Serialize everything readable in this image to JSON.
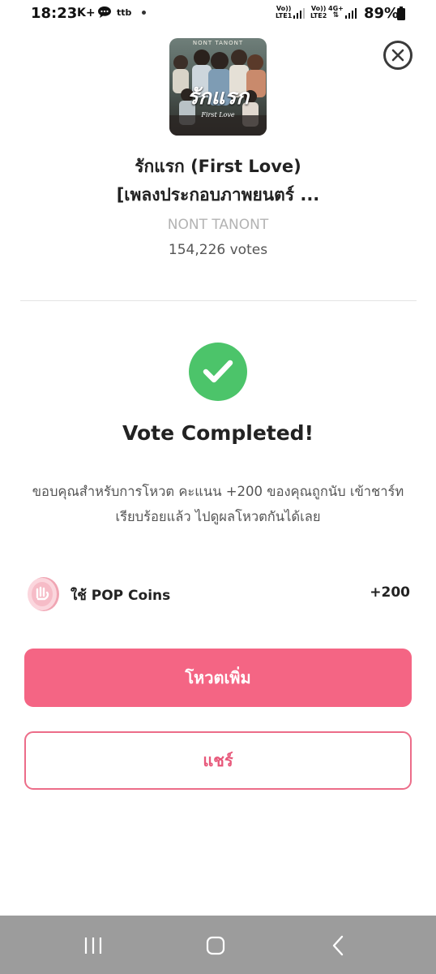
{
  "status_bar": {
    "time": "18:23",
    "carrier_icons": "K+",
    "ttb": "ttb",
    "net1_top": "Vo))",
    "net1_bottom": "LTE1",
    "net2_top": "Vo))",
    "net2_bottom": "LTE2",
    "net3_top": "4G+",
    "battery_pct": "89%"
  },
  "song": {
    "cover_artist_text": "NONT TANONT",
    "cover_title_thai": "รักแรก",
    "cover_title_en": "First Love",
    "title_line1": "รักแรก (First Love)",
    "title_line2": "[เพลงประกอบภาพยนตร์ ...",
    "artist": "NONT TANONT",
    "votes": "154,226 votes"
  },
  "result": {
    "title": "Vote Completed!",
    "message": "ขอบคุณสำหรับการโหวต คะแนน +200 ของคุณถูกนับ เข้าชาร์ทเรียบร้อยแล้ว ไปดูผลโหวตกันได้เลย"
  },
  "coins": {
    "label": "ใช้ POP Coins",
    "value": "+200"
  },
  "buttons": {
    "vote_more": "โหวตเพิ่ม",
    "share": "แชร์"
  },
  "colors": {
    "primary": "#f46584",
    "success": "#4cc46a",
    "nav_bar": "#9c9c9c"
  }
}
